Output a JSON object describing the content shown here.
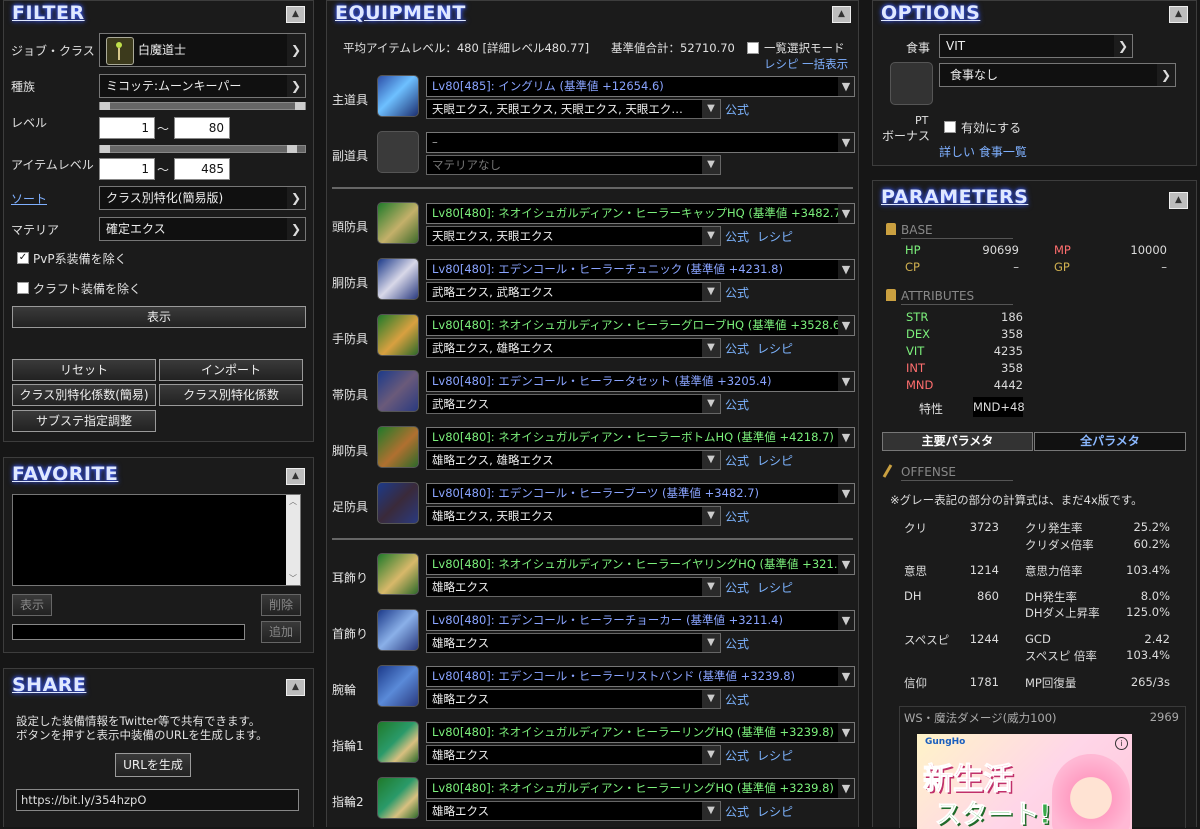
{
  "filter": {
    "title": "FILTER",
    "job_label": "ジョブ・クラス",
    "job_value": "白魔道士",
    "race_label": "種族",
    "race_value": "ミコッテ:ムーンキーパー",
    "level_label": "レベル",
    "level_min": "1",
    "level_max": "80",
    "tilde": "〜",
    "ilevel_label": "アイテムレベル",
    "ilevel_min": "1",
    "ilevel_max": "485",
    "sort_label": "ソート",
    "sort_value": "クラス別特化(簡易版)",
    "materia_label": "マテリア",
    "materia_value": "確定エクス",
    "pvp_label": "PvP系装備を除く",
    "craft_label": "クラフト装備を除く",
    "show_btn": "表示",
    "reset_btn": "リセット",
    "import_btn": "インポート",
    "coef_simple_btn": "クラス別特化係数(簡易)",
    "coef_btn": "クラス別特化係数",
    "substat_btn": "サブステ指定調整"
  },
  "favorite": {
    "title": "FAVORITE",
    "show_btn": "表示",
    "delete_btn": "削除",
    "add_btn": "追加"
  },
  "share": {
    "title": "SHARE",
    "desc1": "設定した装備情報をTwitter等で共有できます。",
    "desc2": "ボタンを押すと表示中装備のURLを生成します。",
    "gen_btn": "URLを生成",
    "url": "https://bit.ly/354hzpO"
  },
  "equipment": {
    "title": "EQUIPMENT",
    "avg_ilvl": "平均アイテムレベル：480 [詳細レベル480.77]",
    "total": "基準値合計：52710.70",
    "list_mode": "一覧選択モード",
    "recipe_bulk": "レシピ 一括表示",
    "official": "公式",
    "recipe": "レシピ",
    "rows": [
      {
        "slot": "主道具",
        "gear": "Lv80[485]: イングリム (基準値 +12654.6)",
        "materia": "天眼エクス, 天眼エクス, 天眼エクス, 天眼エク…",
        "color": "#8aa4ff",
        "recipe": false
      },
      {
        "slot": "副道具",
        "gear": "–",
        "materia": "マテリアなし",
        "color": "#aaaaaa",
        "recipe": false
      },
      {
        "slot": "頭防具",
        "gear": "Lv80[480]: ネオイシュガルディアン・ヒーラーキャップHQ (基準値 +3482.7)",
        "materia": "天眼エクス, 天眼エクス",
        "color": "#7cf07c",
        "recipe": true
      },
      {
        "slot": "胴防具",
        "gear": "Lv80[480]: エデンコール・ヒーラーチュニック (基準値 +4231.8)",
        "materia": "武略エクス, 武略エクス",
        "color": "#8aa4ff",
        "recipe": false
      },
      {
        "slot": "手防具",
        "gear": "Lv80[480]: ネオイシュガルディアン・ヒーラーグローブHQ (基準値 +3528.6)",
        "materia": "武略エクス, 雄略エクス",
        "color": "#7cf07c",
        "recipe": true
      },
      {
        "slot": "帯防具",
        "gear": "Lv80[480]: エデンコール・ヒーラータセット (基準値 +3205.4)",
        "materia": "武略エクス",
        "color": "#8aa4ff",
        "recipe": false
      },
      {
        "slot": "脚防具",
        "gear": "Lv80[480]: ネオイシュガルディアン・ヒーラーボトムHQ (基準値 +4218.7)",
        "materia": "雄略エクス, 雄略エクス",
        "color": "#7cf07c",
        "recipe": true
      },
      {
        "slot": "足防具",
        "gear": "Lv80[480]: エデンコール・ヒーラーブーツ (基準値 +3482.7)",
        "materia": "雄略エクス, 天眼エクス",
        "color": "#8aa4ff",
        "recipe": false
      },
      {
        "slot": "耳飾り",
        "gear": "Lv80[480]: ネオイシュガルディアン・ヒーラーイヤリングHQ (基準値 +321…",
        "materia": "雄略エクス",
        "color": "#7cf07c",
        "recipe": true
      },
      {
        "slot": "首飾り",
        "gear": "Lv80[480]: エデンコール・ヒーラーチョーカー (基準値 +3211.4)",
        "materia": "雄略エクス",
        "color": "#8aa4ff",
        "recipe": false
      },
      {
        "slot": "腕輪",
        "gear": "Lv80[480]: エデンコール・ヒーラーリストバンド (基準値 +3239.8)",
        "materia": "雄略エクス",
        "color": "#8aa4ff",
        "recipe": false
      },
      {
        "slot": "指輪1",
        "gear": "Lv80[480]: ネオイシュガルディアン・ヒーラーリングHQ (基準値 +3239.8)",
        "materia": "雄略エクス",
        "color": "#7cf07c",
        "recipe": true
      },
      {
        "slot": "指輪2",
        "gear": "Lv80[480]: ネオイシュガルディアン・ヒーラーリングHQ (基準値 +3239.8)",
        "materia": "雄略エクス",
        "color": "#7cf07c",
        "recipe": true
      }
    ]
  },
  "options": {
    "title": "OPTIONS",
    "food_label": "食事",
    "food_stat": "VIT",
    "food_value": "食事なし",
    "pt_label1": "PT",
    "pt_label2": "ボーナス",
    "pt_enable": "有効にする",
    "food_list": "詳しい 食事一覧"
  },
  "parameters": {
    "title": "PARAMETERS",
    "base_title": "BASE",
    "hp_label": "HP",
    "hp": "90699",
    "mp_label": "MP",
    "mp": "10000",
    "cp_label": "CP",
    "cp": "–",
    "gp_label": "GP",
    "gp": "–",
    "attr_title": "ATTRIBUTES",
    "attrs": [
      {
        "label": "STR",
        "value": "186"
      },
      {
        "label": "DEX",
        "value": "358"
      },
      {
        "label": "VIT",
        "value": "4235"
      },
      {
        "label": "INT",
        "value": "358"
      },
      {
        "label": "MND",
        "value": "4442"
      }
    ],
    "trait_label": "特性",
    "trait_value": "MND+48",
    "tab_main": "主要パラメタ",
    "tab_all": "全パラメタ",
    "offense_title": "OFFENSE",
    "note": "※グレー表記の部分の計算式は、まだ4x版です。",
    "crit_label": "クリ",
    "crit": "3723",
    "crit_rate_label": "クリ発生率",
    "crit_rate": "25.2%",
    "crit_dmg_label": "クリダメ倍率",
    "crit_dmg": "60.2%",
    "det_label": "意思",
    "det": "1214",
    "det_mult_label": "意思力倍率",
    "det_mult": "103.4%",
    "dh_label": "DH",
    "dh": "860",
    "dh_rate_label": "DH発生率",
    "dh_rate": "8.0%",
    "dh_dmg_label": "DHダメ上昇率",
    "dh_dmg": "125.0%",
    "sps_label": "スペスピ",
    "sps": "1244",
    "gcd_label": "GCD",
    "gcd": "2.42",
    "sps_mult_label": "スペスピ 倍率",
    "sps_mult": "103.4%",
    "piety_label": "信仰",
    "piety": "1781",
    "mp_regen_label": "MP回復量",
    "mp_regen": "265/3s",
    "ws_label": "WS・魔法ダメージ(威力100)",
    "ws_value": "2969"
  },
  "ad": {
    "brand": "GungHo",
    "line1": "新生活",
    "line2": "スタート!"
  }
}
